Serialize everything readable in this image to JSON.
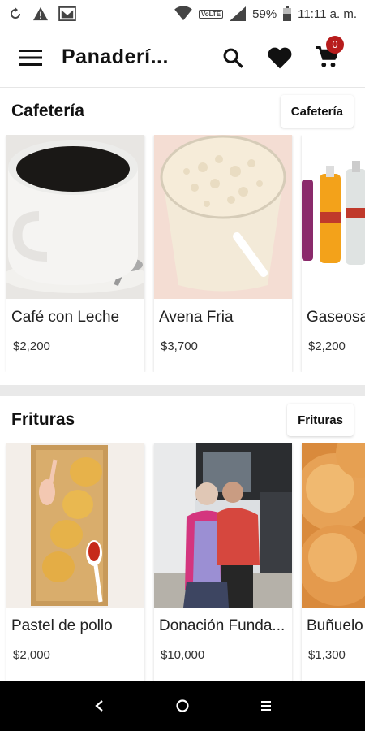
{
  "status_bar": {
    "battery": "59%",
    "time": "11:11 a. m.",
    "network_badge": "VoLTE",
    "icons": [
      "sync-icon",
      "warning-icon",
      "gmail-icon",
      "wifi-icon",
      "signal-icon",
      "battery-icon"
    ]
  },
  "app_bar": {
    "title": "Panaderí...",
    "cart_count": "0",
    "icons": [
      "menu-icon",
      "search-icon",
      "heart-icon",
      "cart-icon"
    ]
  },
  "sections": [
    {
      "title": "Cafetería",
      "chip": "Cafetería",
      "products": [
        {
          "name": "Café con Leche",
          "price": "$2,200"
        },
        {
          "name": "Avena Fria",
          "price": "$3,700"
        },
        {
          "name": "Gaseosa",
          "price": "$2,200"
        }
      ]
    },
    {
      "title": "Frituras",
      "chip": "Frituras",
      "products": [
        {
          "name": "Pastel de pollo",
          "price": "$2,000"
        },
        {
          "name": "Donación Funda...",
          "price": "$10,000"
        },
        {
          "name": "Buñuelo",
          "price": "$1,300"
        }
      ]
    }
  ],
  "nav_bar": {
    "icons": [
      "back-icon",
      "home-icon",
      "recents-icon"
    ]
  },
  "colors": {
    "badge": "#b71c1c",
    "divider": "#e9e9e9",
    "nav_bg": "#000000"
  }
}
